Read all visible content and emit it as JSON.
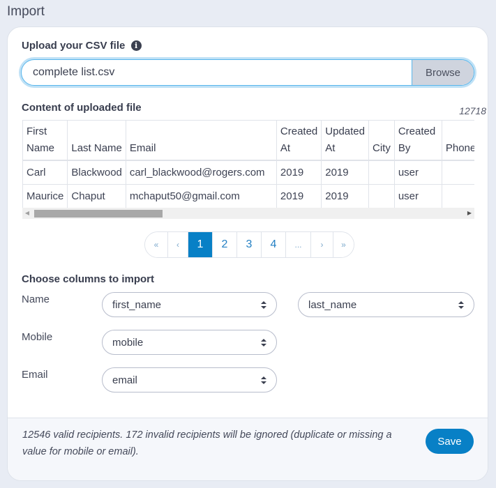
{
  "page": {
    "title": "Import"
  },
  "upload": {
    "label": "Upload your CSV file",
    "info_icon": "info-circle-icon",
    "file_value": "complete list.csv",
    "browse_label": "Browse"
  },
  "content": {
    "label": "Content of uploaded file",
    "row_count": "12718",
    "columns": [
      [
        "First",
        "Name"
      ],
      [
        "",
        "Last Name"
      ],
      [
        "",
        "Email"
      ],
      [
        "Created",
        "At"
      ],
      [
        "Updated",
        "At"
      ],
      [
        "",
        "City"
      ],
      [
        "Created",
        "By"
      ],
      [
        "",
        "Phone"
      ]
    ],
    "rows": [
      [
        "Carl",
        "Blackwood",
        "carl_blackwood@rogers.com",
        "2019",
        "2019",
        "",
        "user",
        ""
      ],
      [
        "Maurice",
        "Chaput",
        "mchaput50@gmail.com",
        "2019",
        "2019",
        "",
        "user",
        ""
      ]
    ]
  },
  "pagination": {
    "first": "«",
    "prev": "‹",
    "pages": [
      "1",
      "2",
      "3",
      "4"
    ],
    "active_page": "1",
    "ellipsis": "...",
    "next": "›",
    "last": "»"
  },
  "columns_import": {
    "label": "Choose columns to import",
    "name_label": "Name",
    "name_first": "first_name",
    "name_last": "last_name",
    "mobile_label": "Mobile",
    "mobile_value": "mobile",
    "email_label": "Email",
    "email_value": "email"
  },
  "footer": {
    "message": "12546 valid recipients. 172 invalid recipients will be ignored (duplicate or missing a value for mobile or email).",
    "save_label": "Save"
  },
  "colors": {
    "accent": "#0880c6",
    "focus_border": "#58b6ec",
    "background": "#e8ecf4"
  }
}
